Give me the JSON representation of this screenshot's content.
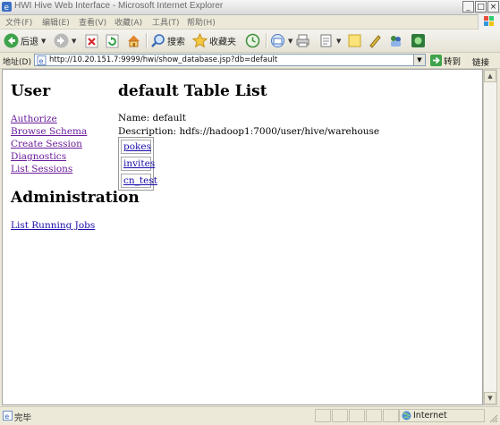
{
  "window": {
    "title": "HWI Hive Web Interface - Microsoft Internet Explorer",
    "minimize": "_",
    "maximize": "□",
    "close": "×"
  },
  "menu": {
    "items": [
      "文件(F)",
      "编辑(E)",
      "查看(V)",
      "收藏(A)",
      "工具(T)",
      "帮助(H)"
    ]
  },
  "toolbar": {
    "back_label": "后退",
    "search_label": "搜索",
    "favorites_label": "收藏夹"
  },
  "address": {
    "label": "地址(D)",
    "url": "http://10.20.151.7:9999/hwi/show_database.jsp?db=default",
    "go_label": "转到",
    "links_label": "链接"
  },
  "page": {
    "sidebar_heading": "User",
    "user_links": [
      "Authorize",
      "Browse Schema",
      "Create Session",
      "Diagnostics",
      "List Sessions"
    ],
    "admin_heading": "Administration",
    "admin_links": [
      "List Running Jobs"
    ],
    "main_heading": "default Table List",
    "name_line": "Name: default",
    "description_line": "Description: hdfs://hadoop1:7000/user/hive/warehouse",
    "tables": [
      "pokes",
      "invites",
      "cn_test"
    ]
  },
  "status": {
    "text": "完毕",
    "zone": "Internet"
  },
  "colors": {
    "visited_link": "#6a1b9a",
    "link": "#1a0dab",
    "chrome": "#ece9d8"
  }
}
